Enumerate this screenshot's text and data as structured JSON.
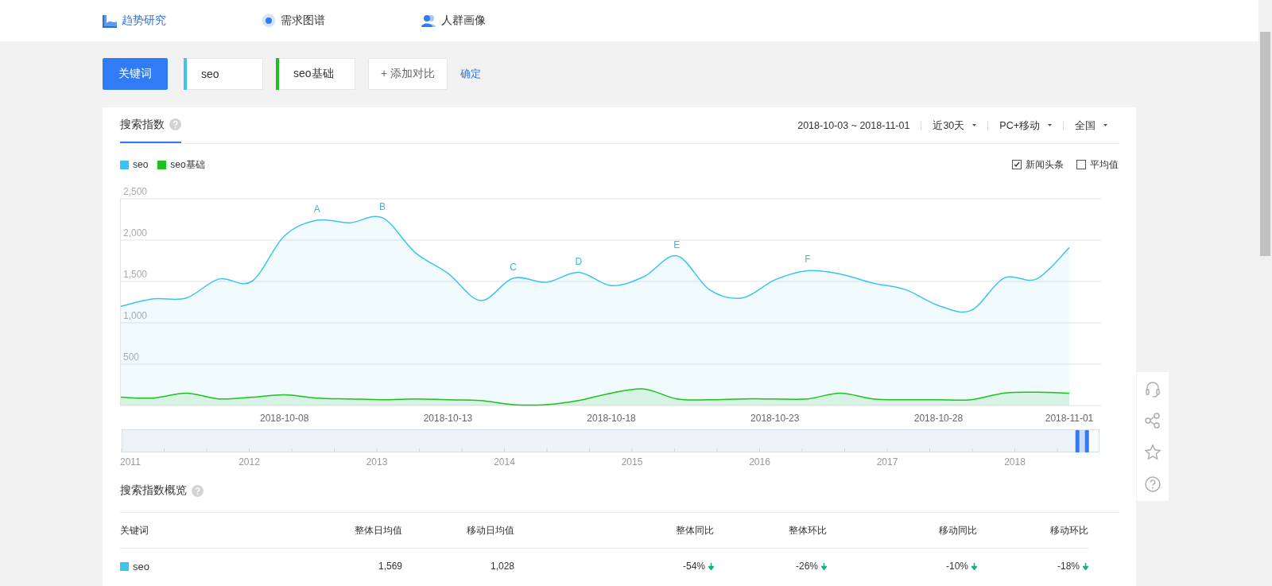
{
  "nav": {
    "items": [
      {
        "label": "趋势研究",
        "selected": true
      },
      {
        "label": "需求图谱",
        "selected": false
      },
      {
        "label": "人群画像",
        "selected": false
      }
    ]
  },
  "keyword_bar": {
    "type_button": "关键词",
    "keywords": [
      {
        "text": "seo",
        "color": "#3bc4ef"
      },
      {
        "text": "seo基础",
        "color": "#1fc01f"
      }
    ],
    "add_button": "+ 添加对比",
    "confirm": "确定"
  },
  "panel": {
    "tab": {
      "label": "搜索指数",
      "selected": true
    },
    "date_range": "2018-10-03 ~ 2018-11-01",
    "filters": [
      "近30天",
      "PC+移动",
      "全国"
    ],
    "options": [
      {
        "label": "新闻头条",
        "checked": true
      },
      {
        "label": "平均值",
        "checked": false
      }
    ],
    "chart_data": {
      "type": "area",
      "grid": true,
      "categories": [
        null,
        null,
        null,
        null,
        null,
        "2018-10-08",
        null,
        null,
        null,
        null,
        "2018-10-13",
        null,
        null,
        null,
        null,
        "2018-10-18",
        null,
        null,
        null,
        null,
        "2018-10-23",
        null,
        null,
        null,
        null,
        "2018-10-28",
        null,
        null,
        null,
        "2018-11-01"
      ],
      "series": [
        {
          "name": "seo",
          "color": "#3bc4ef",
          "values": [
            1200,
            1290,
            1300,
            1530,
            1500,
            2050,
            2240,
            2210,
            2270,
            1850,
            1600,
            1270,
            1540,
            1490,
            1610,
            1450,
            1560,
            1810,
            1400,
            1300,
            1520,
            1630,
            1590,
            1480,
            1400,
            1210,
            1150,
            1540,
            1530,
            1910
          ]
        },
        {
          "name": "seo基础",
          "color": "#1fc01f",
          "values": [
            100,
            90,
            150,
            80,
            100,
            130,
            90,
            80,
            70,
            80,
            70,
            60,
            10,
            10,
            60,
            150,
            200,
            80,
            70,
            80,
            80,
            80,
            150,
            80,
            70,
            70,
            70,
            150,
            160,
            150
          ]
        }
      ],
      "ylim": [
        0,
        2500
      ],
      "yticks": [
        {
          "value": 500,
          "label": "500"
        },
        {
          "value": 1000,
          "label": "1,000"
        },
        {
          "value": 1500,
          "label": "1,500"
        },
        {
          "value": 2000,
          "label": "2,000"
        },
        {
          "value": 2500,
          "label": "2,500"
        }
      ],
      "annotations": [
        {
          "y": 2240,
          "text": "A"
        },
        {
          "y": 2270,
          "text": "B"
        },
        {
          "y": 1540,
          "text": "C"
        },
        {
          "y": 1610,
          "text": "D"
        },
        {
          "y": 1810,
          "text": "E"
        },
        {
          "y": 1630,
          "text": "F"
        }
      ]
    },
    "timeline": {
      "years": [
        "2011",
        "2012",
        "2013",
        "2014",
        "2015",
        "2016",
        "2017",
        "2018"
      ],
      "level": 0.99
    }
  },
  "overview": {
    "title": "搜索指数概览",
    "columns": [
      "关键词",
      "整体日均值",
      "移动日均值",
      "整体同比",
      "整体环比",
      "移动同比",
      "移动环比"
    ],
    "rows": [
      {
        "keyword": "seo",
        "color": "#3bc4ef",
        "averages": [
          "1,569",
          "1,028"
        ],
        "changes": [
          {
            "text": "-54%",
            "down": true
          },
          {
            "text": "-26%",
            "down": true
          },
          {
            "text": "-10%",
            "down": true
          },
          {
            "text": "-18%",
            "down": true
          }
        ]
      }
    ]
  }
}
